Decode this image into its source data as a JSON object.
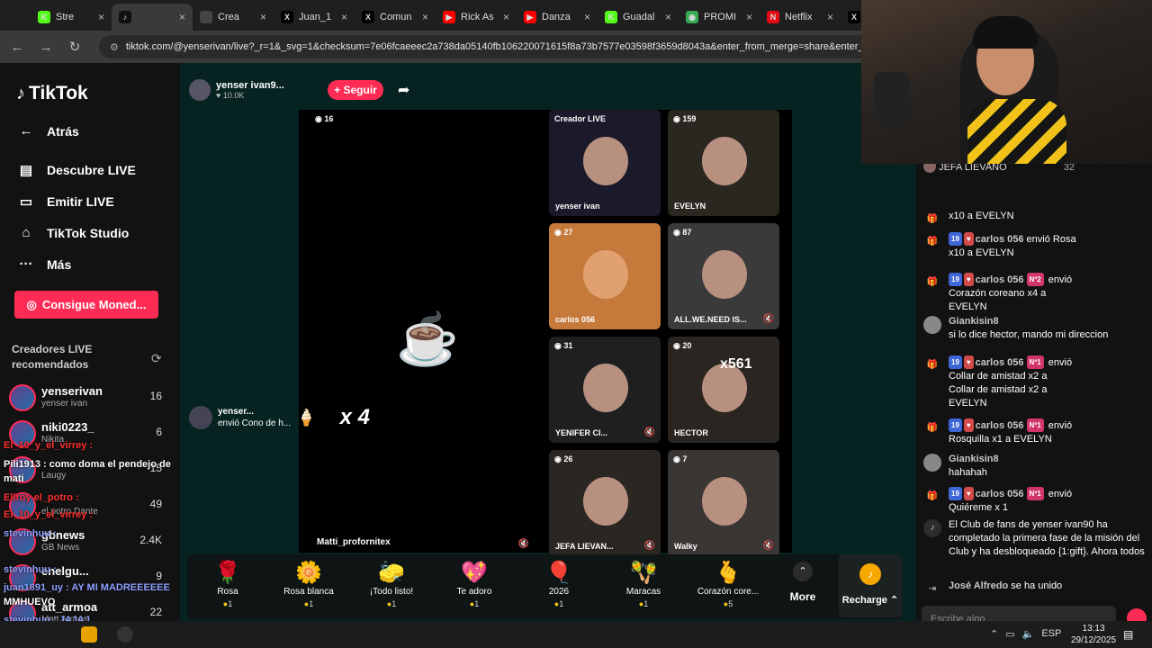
{
  "browser": {
    "tabs": [
      {
        "label": "Stre",
        "icon": "K",
        "color": "#53fc18"
      },
      {
        "label": "",
        "icon": "tiktok",
        "color": "#111111",
        "active": true
      },
      {
        "label": "Crea",
        "icon": "",
        "color": "#444444"
      },
      {
        "label": "Juan_1",
        "icon": "X",
        "color": "#000000"
      },
      {
        "label": "Comun",
        "icon": "X",
        "color": "#000000"
      },
      {
        "label": "Rick As",
        "icon": "▶",
        "color": "#ff0000"
      },
      {
        "label": "Danza",
        "icon": "▶",
        "color": "#ff0000"
      },
      {
        "label": "Guadal",
        "icon": "K",
        "color": "#53fc18"
      },
      {
        "label": "PROMI",
        "icon": "◉",
        "color": "#34a853"
      },
      {
        "label": "Netflix",
        "icon": "N",
        "color": "#e50914"
      },
      {
        "label": "J",
        "icon": "X",
        "color": "#000000"
      }
    ],
    "url": "tiktok.com/@yenserivan/live?_r=1&_svg=1&checksum=7e06fcaeeec2a738da05140fb106220071615f8a73b7577e03598f3659d8043a&enter_from_merge=share&enter_m"
  },
  "sidebar": {
    "logo": "TikTok",
    "nav": [
      {
        "label": "Atrás",
        "icon": "arrow-left-icon"
      },
      {
        "label": "Descubre LIVE",
        "icon": "tv-icon"
      },
      {
        "label": "Emitir LIVE",
        "icon": "camera-icon"
      },
      {
        "label": "TikTok Studio",
        "icon": "house-icon"
      },
      {
        "label": "Más",
        "icon": "more-icon"
      }
    ],
    "coins_button": "Consigue Moned...",
    "recommended_title": "Creadores LIVE recomendados",
    "creators": [
      {
        "name": "yenserivan",
        "sub": "yenser ivan",
        "count": "16"
      },
      {
        "name": "niki0223_",
        "sub": "Nikita",
        "count": "6"
      },
      {
        "name": "",
        "sub": "Laugy",
        "count": "15"
      },
      {
        "name": "",
        "sub": "el potro Dante",
        "count": "49"
      },
      {
        "name": "gbnews",
        "sub": "GB News",
        "count": "2.4K"
      },
      {
        "name": "enelgu...",
        "sub": "",
        "count": "9"
      },
      {
        "name": "att_armoa",
        "sub": "Matt Armoa",
        "count": "22"
      }
    ]
  },
  "overlay_chat": [
    {
      "text": "El_10_y_el_virrey :",
      "color": "#ff3030"
    },
    {
      "text": "Pili1913 : como doma el pendejo de",
      "color": "#ffffff"
    },
    {
      "text": "mati",
      "color": "#ffffff"
    },
    {
      "text": "Ellroy el_potro :",
      "color": "#ff3030"
    },
    {
      "text": "El_10_y_el_virrey :",
      "color": "#ff3030"
    },
    {
      "text": "stevinhuu :",
      "color": "#8fa0ff"
    },
    {
      "text": "stevinhuu :",
      "color": "#8fa0ff"
    },
    {
      "text": "juan1891_uy : AY MI MADREEEEEE",
      "color": "#8fa0ff"
    },
    {
      "text": "MMHUEVO",
      "color": "#ffffff"
    },
    {
      "text": "stevinhuu : JAJAJ",
      "color": "#8fa0ff"
    },
    {
      "text": "juan1891_uy :",
      "color": "#8fa0ff"
    }
  ],
  "live": {
    "host_name": "yenser ivan9...",
    "host_viewers": "10.0K",
    "follow_button": "+ Seguir",
    "main_viewers": "16",
    "main_name": "Matti_profornitex",
    "gift_notice": {
      "user": "yenser...",
      "text": "envió Cono de h...",
      "multiplier": "x 4"
    },
    "guests": [
      {
        "label": "Creador LIVE",
        "count": "",
        "name": "yenser ivan",
        "bg": "#1a1a2a"
      },
      {
        "label": "",
        "count": "159",
        "name": "EVELYN",
        "bg": "#2a2620"
      },
      {
        "label": "",
        "count": "27",
        "name": "carlos 056",
        "bg": "#c57a3b"
      },
      {
        "label": "",
        "count": "87",
        "name": "ALL.WE.NEED IS...",
        "bg": "#3a3a3a"
      },
      {
        "label": "",
        "count": "31",
        "name": "YENIFER CI...",
        "bg": "#1f1f1f"
      },
      {
        "label": "",
        "count": "20",
        "name": "HECTOR",
        "bg": "#2a2520",
        "overlay": "x561"
      },
      {
        "label": "",
        "count": "26",
        "name": "JEFA LIEVAN...",
        "bg": "#2a2622"
      },
      {
        "label": "",
        "count": "7",
        "name": "Walky",
        "bg": "#3a3634"
      }
    ]
  },
  "gifts": [
    {
      "name": "Rosa",
      "price": "1",
      "icon": "🌹"
    },
    {
      "name": "Rosa blanca",
      "price": "1",
      "icon": "🌼"
    },
    {
      "name": "¡Todo listo!",
      "price": "1",
      "icon": "🧽"
    },
    {
      "name": "Te adoro",
      "price": "1",
      "icon": "💖"
    },
    {
      "name": "2026",
      "price": "1",
      "icon": "🎈"
    },
    {
      "name": "Maracas",
      "price": "1",
      "icon": "🪇"
    },
    {
      "name": "Corazón core...",
      "price": "5",
      "icon": "🫰"
    }
  ],
  "gift_more": "More",
  "recharge": "Recharge",
  "chat": {
    "pinned_user": "JEFA LIEVANO",
    "pinned_count": "32",
    "messages": [
      {
        "type": "gift",
        "text": "x10 a  EVELYN"
      },
      {
        "type": "gift",
        "user": "carlos 056",
        "action": "envió Rosa",
        "line2": "x10 a  EVELYN"
      },
      {
        "type": "gift",
        "user": "carlos 056",
        "badge": "Nº2",
        "action": "envió",
        "line2": "Corazón coreano  x4 a",
        "line3": "EVELYN"
      },
      {
        "type": "msg",
        "user": "Giankisin8",
        "text": "si lo dice hector, mando mi direccion"
      },
      {
        "type": "gift",
        "user": "carlos 056",
        "badge": "Nº1",
        "action": "envió",
        "line2": "Collar de amistad  x2 a",
        "line3": "Collar de amistad  x2 a",
        "line4": "EVELYN"
      },
      {
        "type": "gift",
        "user": "carlos 056",
        "badge": "Nº1",
        "action": "envió",
        "line2": "Rosquilla  x1 a  EVELYN"
      },
      {
        "type": "msg",
        "user": "Giankisin8",
        "text": "hahahah"
      },
      {
        "type": "gift",
        "user": "carlos 056",
        "badge": "Nº1",
        "action": "envió",
        "line2": "Quiéreme  x 1"
      },
      {
        "type": "club",
        "text": "El Club de fans de  yenser ivan90  ha completado la primera fase de la misión del Club y ha desbloqueado {1:gift}. Ahora todos"
      },
      {
        "type": "join",
        "user": "José Alfredo",
        "text": "se ha unido"
      }
    ],
    "input_placeholder": "Escribe algo..."
  },
  "taskbar": {
    "lang": "ESP",
    "time": "13:13",
    "date": "29/12/2025"
  }
}
